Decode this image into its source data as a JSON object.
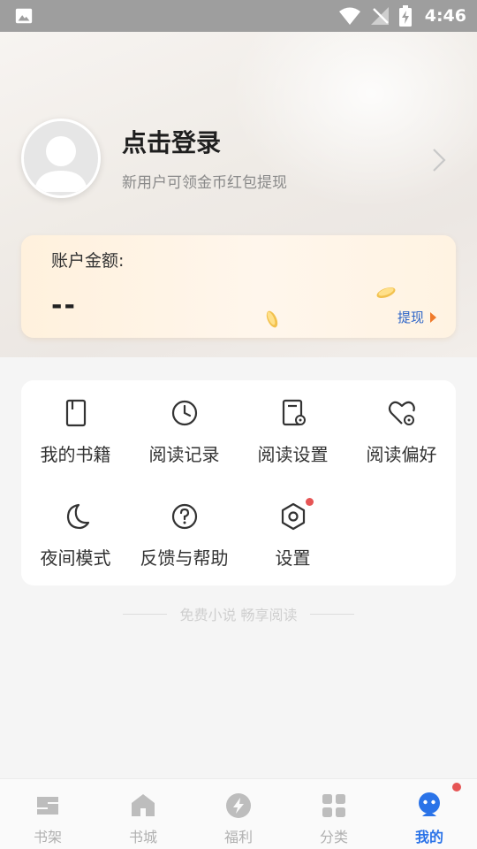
{
  "status_bar": {
    "time": "4:46"
  },
  "profile": {
    "login_title": "点击登录",
    "login_subtitle": "新用户可领金币红包提现"
  },
  "account": {
    "label": "账户金额:",
    "amount": "--",
    "withdraw_label": "提现"
  },
  "menu": {
    "items": [
      {
        "label": "我的书籍",
        "icon": "book-icon"
      },
      {
        "label": "阅读记录",
        "icon": "clock-icon"
      },
      {
        "label": "阅读设置",
        "icon": "reading-settings-icon"
      },
      {
        "label": "阅读偏好",
        "icon": "heart-settings-icon"
      },
      {
        "label": "夜间模式",
        "icon": "moon-icon"
      },
      {
        "label": "反馈与帮助",
        "icon": "help-icon"
      },
      {
        "label": "设置",
        "icon": "settings-hex-icon",
        "badge": true
      }
    ]
  },
  "tagline": "免费小说 畅享阅读",
  "bottom_nav": {
    "items": [
      {
        "label": "书架",
        "icon": "bookshelf-icon"
      },
      {
        "label": "书城",
        "icon": "home-icon"
      },
      {
        "label": "福利",
        "icon": "bolt-icon"
      },
      {
        "label": "分类",
        "icon": "grid-icon"
      },
      {
        "label": "我的",
        "icon": "profile-face-icon",
        "active": true,
        "badge": true
      }
    ]
  },
  "colors": {
    "accent": "#2a73e8",
    "badge": "#e65555",
    "status_bar": "#9e9e9e"
  }
}
